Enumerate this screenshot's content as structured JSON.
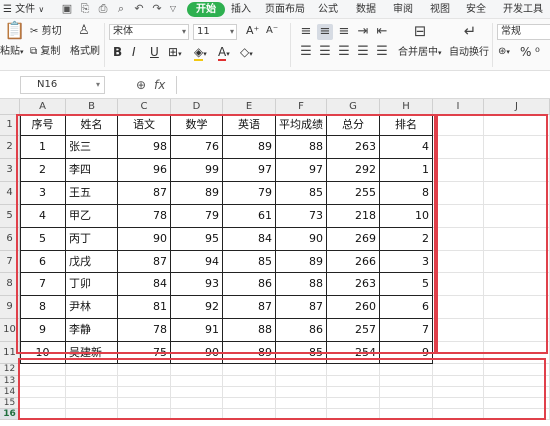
{
  "menubar": {
    "file_label": "文件",
    "tabs": [
      "开始",
      "插入",
      "页面布局",
      "公式",
      "数据",
      "审阅",
      "视图",
      "安全",
      "开发工具"
    ],
    "active_tab": "开始"
  },
  "ribbon": {
    "paste": "粘贴",
    "cut": "剪切",
    "copy": "复制",
    "format_painter": "格式刷",
    "font_name": "宋体",
    "font_size": "11",
    "bold": "B",
    "italic": "I",
    "underline": "U",
    "merge_center": "合并居中",
    "wrap_text": "自动换行",
    "number_format": "常规",
    "percent": "%",
    "grow_font": "A⁺",
    "shrink_font": "A⁻"
  },
  "formula_bar": {
    "name_box": "N16",
    "fx_label": "fx",
    "value": ""
  },
  "sheet": {
    "columns": [
      "A",
      "B",
      "C",
      "D",
      "E",
      "F",
      "G",
      "H",
      "I",
      "J"
    ],
    "rows": [
      "1",
      "2",
      "3",
      "4",
      "5",
      "6",
      "7",
      "8",
      "9",
      "10",
      "11",
      "12",
      "13",
      "14",
      "15",
      "16"
    ],
    "selected_row": "16",
    "headers": [
      "序号",
      "姓名",
      "语文",
      "数学",
      "英语",
      "平均成绩",
      "总分",
      "排名"
    ],
    "data": [
      [
        "1",
        "张三",
        "98",
        "76",
        "89",
        "88",
        "263",
        "4"
      ],
      [
        "2",
        "李四",
        "96",
        "99",
        "97",
        "97",
        "292",
        "1"
      ],
      [
        "3",
        "王五",
        "87",
        "89",
        "79",
        "85",
        "255",
        "8"
      ],
      [
        "4",
        "甲乙",
        "78",
        "79",
        "61",
        "73",
        "218",
        "10"
      ],
      [
        "5",
        "丙丁",
        "90",
        "95",
        "84",
        "90",
        "269",
        "2"
      ],
      [
        "6",
        "戊戌",
        "87",
        "94",
        "85",
        "89",
        "266",
        "3"
      ],
      [
        "7",
        "丁卯",
        "84",
        "93",
        "86",
        "88",
        "263",
        "5"
      ],
      [
        "8",
        "尹林",
        "81",
        "92",
        "87",
        "87",
        "260",
        "6"
      ],
      [
        "9",
        "李静",
        "78",
        "91",
        "88",
        "86",
        "257",
        "7"
      ],
      [
        "10",
        "吴建新",
        "75",
        "90",
        "89",
        "85",
        "254",
        "9"
      ]
    ]
  },
  "colors": {
    "accent_green": "#2eb050",
    "highlight_red": "#e0404a"
  }
}
